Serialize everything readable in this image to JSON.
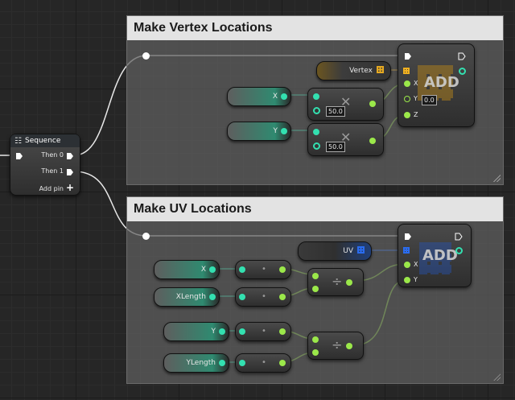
{
  "comments": {
    "vertex": {
      "title": "Make Vertex Locations"
    },
    "uv": {
      "title": "Make UV Locations"
    }
  },
  "sequence": {
    "title": "Sequence",
    "then0": "Then 0",
    "then1": "Then 1",
    "addpin": "Add pin"
  },
  "vertex_group": {
    "vertex_var": "Vertex",
    "x_var": "X",
    "y_var": "Y",
    "mult1_value": "50.0",
    "mult2_value": "50.0",
    "add_node": {
      "label": "ADD",
      "pin_x": "X",
      "pin_y": "Y",
      "pin_z": "Z",
      "y_value": "0.0"
    }
  },
  "uv_group": {
    "uv_var": "UV",
    "x_var": "X",
    "xlength_var": "XLength",
    "y_var": "Y",
    "ylength_var": "YLength",
    "div_symbol": "÷",
    "add_node": {
      "label": "ADD",
      "pin_x": "X",
      "pin_y": "Y"
    }
  },
  "colors": {
    "float_pin": "#9be84a",
    "vector_pin": "#33e0b0",
    "array_pin": "#f0b020",
    "uv_pin": "#2a6cf0",
    "exec_pin": "#ffffff",
    "comment_header": "#e3e3e3"
  }
}
